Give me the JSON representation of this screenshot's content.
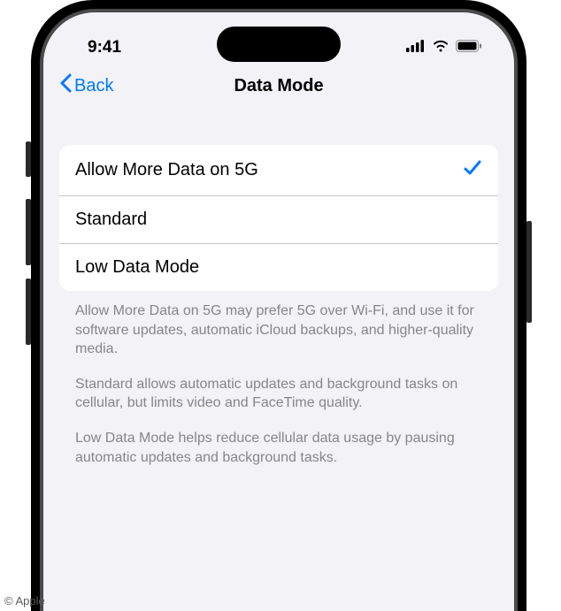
{
  "status": {
    "time": "9:41"
  },
  "nav": {
    "back_label": "Back",
    "title": "Data Mode"
  },
  "options": {
    "allow_more_5g": "Allow More Data on 5G",
    "standard": "Standard",
    "low_data": "Low Data Mode",
    "selected": "allow_more_5g"
  },
  "footer": {
    "p1": "Allow More Data on 5G may prefer 5G over Wi-Fi, and use it for software updates, automatic iCloud backups, and higher-quality media.",
    "p2": "Standard allows automatic updates and background tasks on cellular, but limits video and FaceTime quality.",
    "p3": "Low Data Mode helps reduce cellular data usage by pausing automatic updates and background tasks."
  },
  "copyright": "© Apple"
}
